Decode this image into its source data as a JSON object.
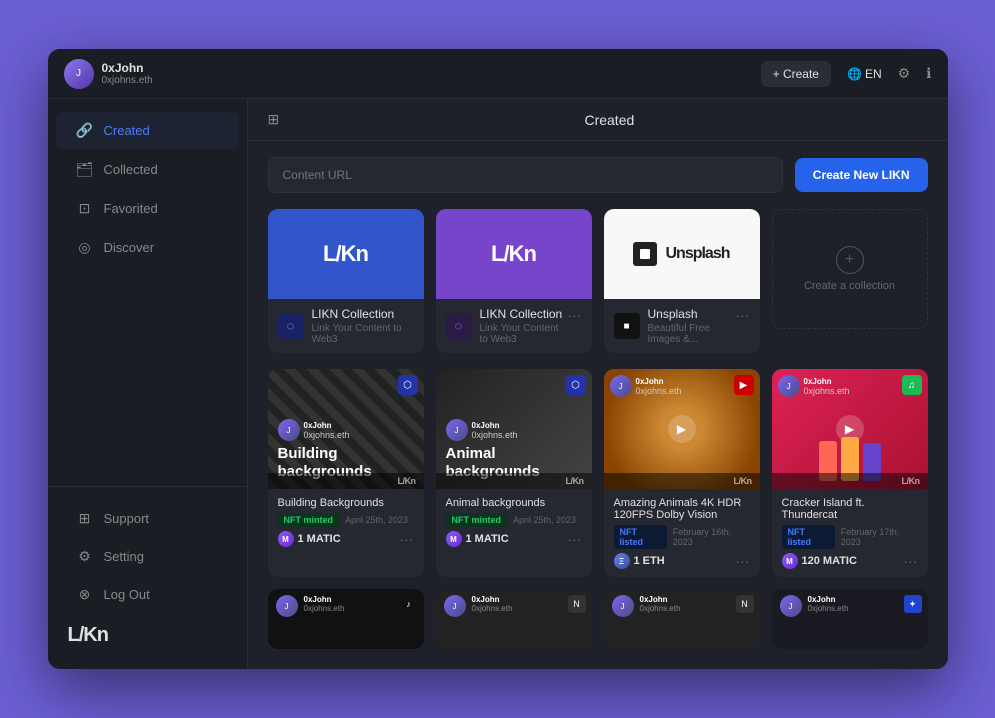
{
  "window": {
    "title": "Created"
  },
  "topbar": {
    "user": {
      "name": "0xJohn",
      "handle": "0xjohns.eth"
    },
    "create_label": "+ Create",
    "lang_label": "EN",
    "settings_icon": "⚙",
    "info_icon": "ℹ"
  },
  "sidebar": {
    "nav_items": [
      {
        "id": "created",
        "label": "Created",
        "icon": "🔗",
        "active": true
      },
      {
        "id": "collected",
        "label": "Collected",
        "icon": "🗂"
      },
      {
        "id": "favorited",
        "label": "Favorited",
        "icon": "⊡"
      },
      {
        "id": "discover",
        "label": "Discover",
        "icon": "◎"
      }
    ],
    "bottom_items": [
      {
        "id": "support",
        "label": "Support",
        "icon": "⊞"
      },
      {
        "id": "setting",
        "label": "Setting",
        "icon": "⚙"
      },
      {
        "id": "logout",
        "label": "Log Out",
        "icon": "⊗"
      }
    ],
    "logo": "L/Kn"
  },
  "content": {
    "header_title": "Created",
    "url_placeholder": "Content URL",
    "create_likn_btn": "Create New LIKN"
  },
  "collections": [
    {
      "id": "likn-collection-1",
      "bg_class": "blue-bg",
      "logo": "L/Kn",
      "title": "LIKN Collection",
      "desc": "Link Your Content to Web3"
    },
    {
      "id": "likn-collection-2",
      "bg_class": "purple-bg",
      "logo": "L/Kn",
      "title": "LIKN Collection",
      "desc": "Link Your Content to Web3"
    },
    {
      "id": "unsplash",
      "bg_class": "white-bg",
      "logo": "Unsplash",
      "title": "Unsplash",
      "desc": "Beautiful Free Images &..."
    }
  ],
  "create_collection_label": "Create a collection",
  "nfts": [
    {
      "id": "building-backgrounds",
      "title": "Building Backgrounds",
      "card_title": "Building backgrounds",
      "style": "building",
      "user": "0xJohn",
      "handle": "0xjohns.eth",
      "platform": "likn",
      "status": "NFT minted",
      "status_class": "badge-green",
      "date": "April 25th, 2023",
      "price": "1 MATIC",
      "currency": "matic"
    },
    {
      "id": "animal-backgrounds",
      "title": "Animal backgrounds",
      "card_title": "Animal backgrounds",
      "style": "animal",
      "user": "0xJohn",
      "handle": "0xjohns.eth",
      "platform": "likn",
      "status": "NFT minted",
      "status_class": "badge-green",
      "date": "April 25th, 2023",
      "price": "1 MATIC",
      "currency": "matic"
    },
    {
      "id": "amazing-animals",
      "title": "Amazing Animals 4K HDR 120FPS Dolby Vision",
      "style": "cat",
      "user": "0xJohn",
      "handle": "0xjohns.eth",
      "platform": "youtube",
      "status": "NFT listed",
      "status_class": "badge-blue",
      "date": "February 16th, 2023",
      "price": "1 ETH",
      "currency": "eth"
    },
    {
      "id": "cracker-island",
      "title": "Cracker Island ft. Thundercat",
      "style": "cracker",
      "user": "0xJohn",
      "handle": "0xjohns.eth",
      "platform": "spotify",
      "status": "NFT listed",
      "status_class": "badge-blue",
      "date": "February 17th, 2023",
      "price": "120 MATIC",
      "currency": "matic"
    }
  ],
  "partial_cards": [
    {
      "id": "tiktok-card",
      "style": "tiktok-bg",
      "user": "0xJohn",
      "handle": "0xjohns.eth",
      "platform": "tiktok"
    },
    {
      "id": "notion-card-1",
      "style": "notion-bg",
      "user": "0xJohn",
      "handle": "0xjohns.eth",
      "platform": "notion"
    },
    {
      "id": "notion-card-2",
      "style": "notion-bg",
      "user": "0xJohn",
      "handle": "0xjohns.eth",
      "platform": "notion"
    },
    {
      "id": "dark-card",
      "style": "tiktok-bg",
      "user": "0xJohn",
      "handle": "0xjohns.eth",
      "platform": "figma"
    }
  ],
  "icons": {
    "search": "⌕",
    "grid": "⊞",
    "play": "▶",
    "more": "•••",
    "plus": "+",
    "globe": "🌐"
  }
}
